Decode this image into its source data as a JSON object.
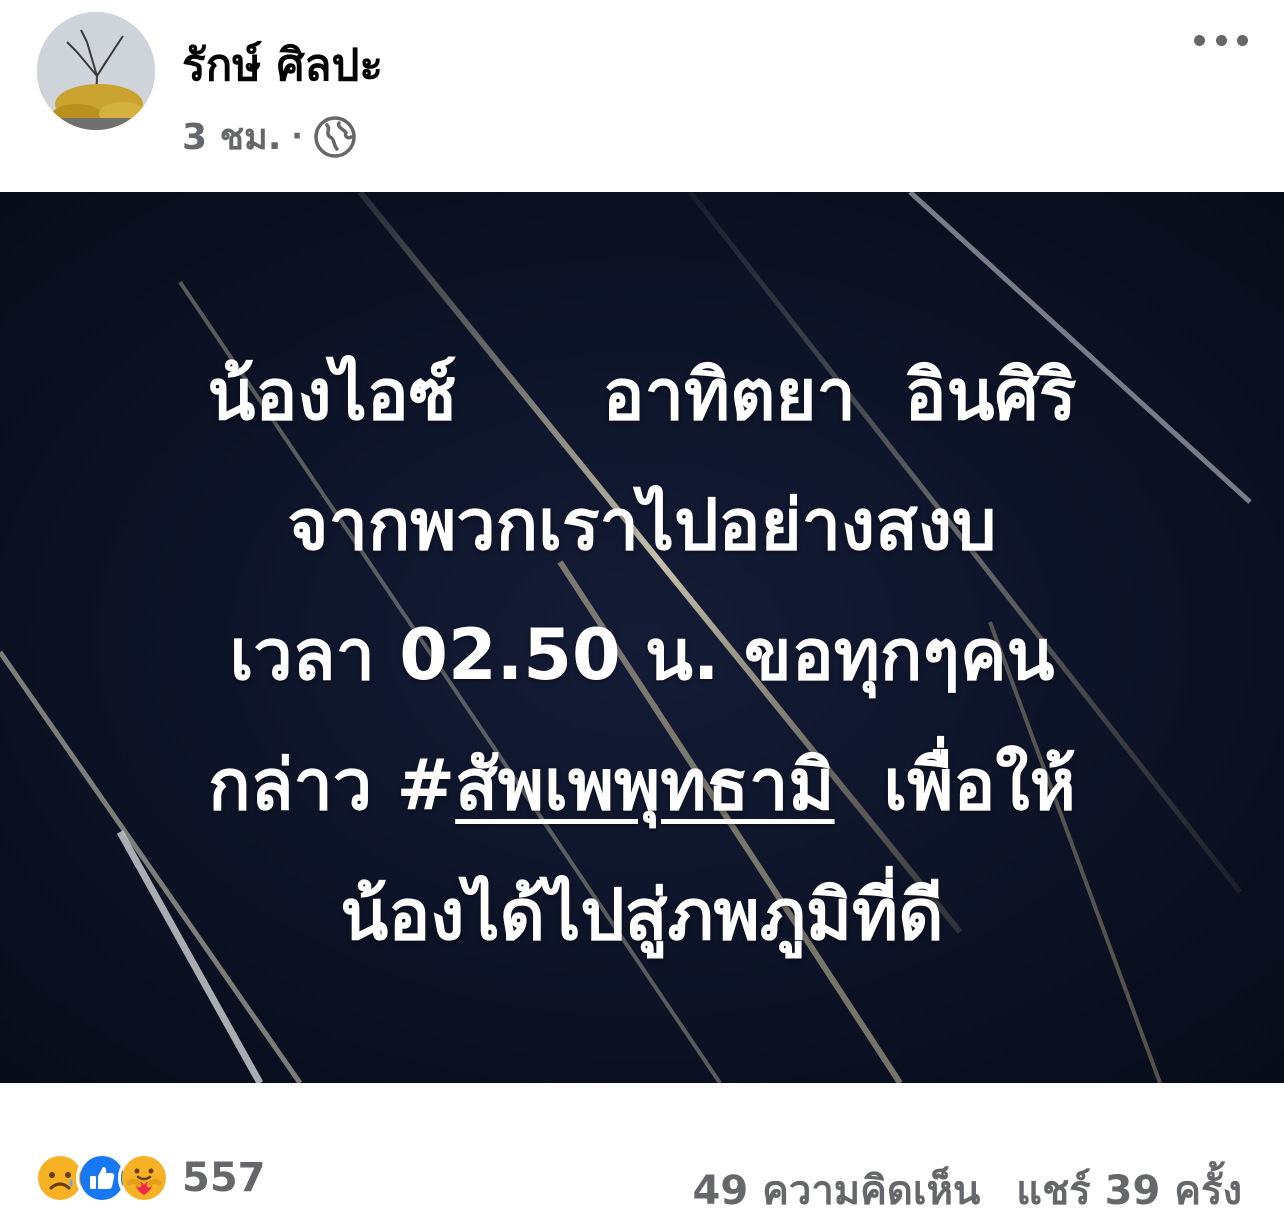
{
  "post": {
    "author": "รักษ์ ศิลปะ",
    "time": "3 ชม.",
    "separator": "·",
    "privacy_icon": "globe-icon",
    "more_icon": "more-options-icon"
  },
  "image": {
    "lines": [
      "น้องไอซ์      อาทิตยา  อินศิริ",
      "จากพวกเราไปอย่างสงบ",
      "เวลา 02.50 น. ขอทุกๆคน"
    ],
    "line4_prefix": "กล่าว #",
    "line4_hashtag": "สัพเพพุทธามิ",
    "line4_suffix": "  เพื่อให้",
    "line5": "น้องได้ไปสู่ภพภูมิที่ดี"
  },
  "footer": {
    "reactions": [
      "sad-reaction-icon",
      "like-reaction-icon",
      "care-reaction-icon"
    ],
    "reaction_count": "557",
    "comments": "49 ความคิดเห็น",
    "shares": "แชร์ 39 ครั้ง"
  },
  "colors": {
    "background": "#0e1428",
    "text_primary": "#050505",
    "text_secondary": "#65676b",
    "like_blue": "#1877f2",
    "reaction_yellow": "#f7b125"
  }
}
